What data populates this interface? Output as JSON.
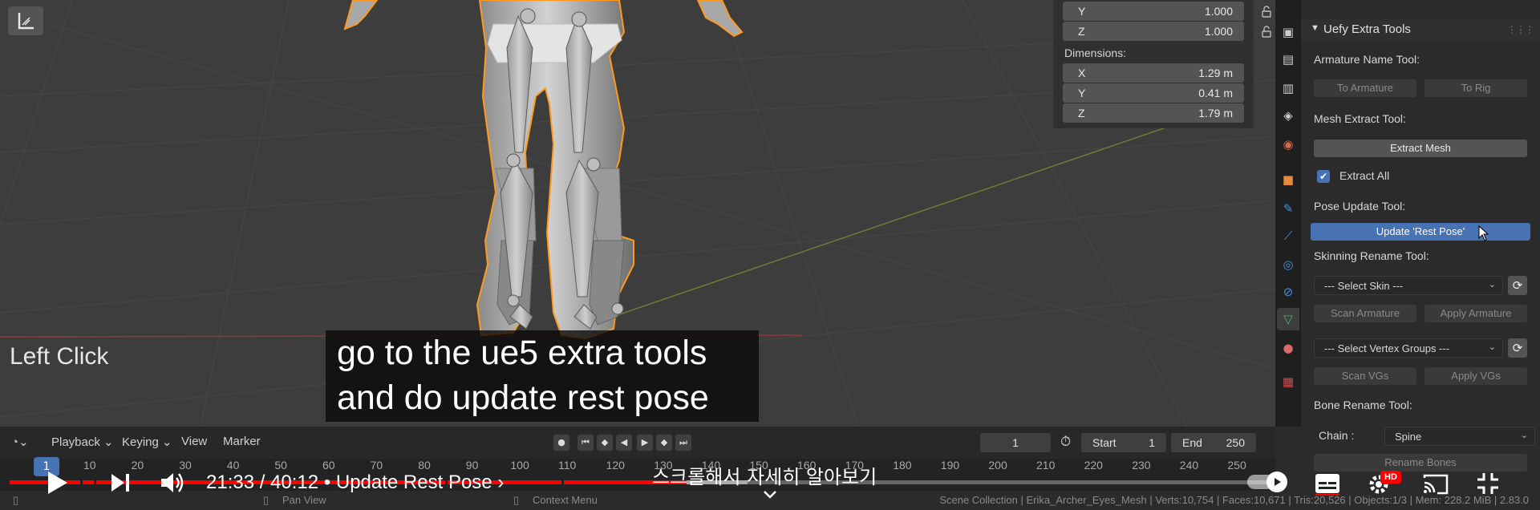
{
  "viewport": {
    "overlay_text": "Left Click",
    "transform": {
      "rows_top": [
        {
          "axis": "Y",
          "value": "1.000"
        },
        {
          "axis": "Z",
          "value": "1.000"
        }
      ],
      "dimensions_label": "Dimensions:",
      "dimensions": [
        {
          "axis": "X",
          "value": "1.29 m"
        },
        {
          "axis": "Y",
          "value": "0.41 m"
        },
        {
          "axis": "Z",
          "value": "1.79 m"
        }
      ]
    }
  },
  "uefy": {
    "panel_title": "Uefy Extra Tools",
    "armature_name_label": "Armature Name Tool:",
    "to_armature": "To Armature",
    "to_rig": "To Rig",
    "mesh_extract_label": "Mesh Extract Tool:",
    "extract_mesh": "Extract Mesh",
    "extract_all": "Extract All",
    "pose_update_label": "Pose Update Tool:",
    "update_rest_pose": "Update 'Rest Pose'",
    "skinning_rename_label": "Skinning Rename Tool:",
    "select_skin": "--- Select Skin ---",
    "scan_armature": "Scan Armature",
    "apply_armature": "Apply Armature",
    "select_vertex_groups": "--- Select Vertex Groups ---",
    "scan_vgs": "Scan VGs",
    "apply_vgs": "Apply VGs",
    "bone_rename_label": "Bone Rename Tool:",
    "chain_label": "Chain :",
    "chain_value": "Spine",
    "rename_bones": "Rename Bones"
  },
  "timeline": {
    "menu": [
      "Playback",
      "Keying",
      "View",
      "Marker"
    ],
    "current_frame": "1",
    "start_label": "Start",
    "start_value": "1",
    "end_label": "End",
    "end_value": "250",
    "frame_indicator": "1",
    "ruler": [
      "10",
      "20",
      "30",
      "40",
      "50",
      "60",
      "70",
      "80",
      "90",
      "100",
      "110",
      "120",
      "130",
      "140",
      "150",
      "160",
      "170",
      "180",
      "190",
      "200",
      "210",
      "220",
      "230",
      "240",
      "250"
    ]
  },
  "statusbar": {
    "pan_view": "Pan View",
    "context_menu": "Context Menu",
    "info": "Scene Collection | Erika_Archer_Eyes_Mesh | Verts:10,754 | Faces:10,671 | Tris:20,526 | Objects:1/3 | Mem: 228.2 MiB | 2.83.0"
  },
  "subtitle": {
    "line1": "go to the ue5 extra tools",
    "line2": "and do update rest pose"
  },
  "player": {
    "time": "21:33 / 40:12",
    "separator": " • ",
    "chapter": "Update Rest Pose",
    "chapter_arrow": "›",
    "scroll_hint": "스크롤해서 자세히 알아보기",
    "hd_badge": "HD",
    "progress_fraction": 0.537,
    "buffered_fraction": 0.585,
    "played_color": "#ff0000"
  },
  "colors": {
    "blender_blue": "#4772b3",
    "selection_orange": "#ff9a1f",
    "viewport_bg": "#3d3d3d"
  }
}
